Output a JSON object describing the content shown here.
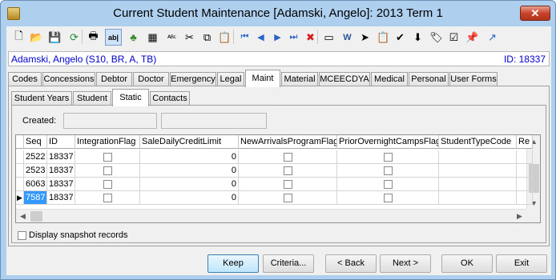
{
  "window": {
    "title": "Current Student Maintenance  [Adamski, Angelo]:  2013 Term 1",
    "close_glyph": "✕"
  },
  "toolbar": {
    "buttons": [
      {
        "name": "new-icon",
        "glyph": "🗋"
      },
      {
        "name": "open-folder-icon",
        "glyph": "📂"
      },
      {
        "name": "save-icon",
        "glyph": "💾"
      },
      {
        "name": "refresh-icon",
        "glyph": "⟳"
      },
      {
        "name": "print-icon",
        "glyph": "🖶"
      },
      {
        "name": "field-view-icon",
        "glyph": "ab|",
        "pressed": true
      },
      {
        "name": "tree-icon",
        "glyph": "♣"
      },
      {
        "name": "calculator-icon",
        "glyph": "▦"
      },
      {
        "name": "spellcheck-icon",
        "glyph": "ᴬᴮᶜ"
      },
      {
        "name": "cut-icon",
        "glyph": "✂"
      },
      {
        "name": "copy-icon",
        "glyph": "⧉"
      },
      {
        "name": "paste-icon",
        "glyph": "📋"
      },
      {
        "name": "first-record-icon",
        "glyph": "⏮"
      },
      {
        "name": "previous-record-icon",
        "glyph": "◀"
      },
      {
        "name": "next-record-icon",
        "glyph": "▶"
      },
      {
        "name": "last-record-icon",
        "glyph": "⏭"
      },
      {
        "name": "delete-icon",
        "glyph": "✖"
      },
      {
        "name": "form-icon",
        "glyph": "▭"
      },
      {
        "name": "word-icon",
        "glyph": "W"
      },
      {
        "name": "send-icon",
        "glyph": "➤"
      },
      {
        "name": "clipboard-icon",
        "glyph": "📋"
      },
      {
        "name": "approve-icon",
        "glyph": "✔"
      },
      {
        "name": "download-icon",
        "glyph": "⬇"
      },
      {
        "name": "tag-icon",
        "glyph": "🏷"
      },
      {
        "name": "checklist-icon",
        "glyph": "☑"
      },
      {
        "name": "pin-icon",
        "glyph": "📌"
      },
      {
        "name": "arrow-up-right-icon",
        "glyph": "↗"
      }
    ]
  },
  "student": {
    "name": "Adamski, Angelo (S10, BR, A, TB)",
    "id_label": "ID: 18337"
  },
  "main_tabs": [
    "Codes",
    "Concessions",
    "Debtor",
    "Doctor",
    "Emergency",
    "Legal",
    "Maint",
    "Material",
    "MCEECDYA",
    "Medical",
    "Personal",
    "User Forms"
  ],
  "main_active_tab": "Maint",
  "sub_tabs": [
    "Student Years",
    "Student",
    "Static",
    "Contacts"
  ],
  "sub_active_tab": "Static",
  "created": {
    "label": "Created:",
    "value1": "",
    "value2": ""
  },
  "grid": {
    "columns": [
      "Seq",
      "ID",
      "IntegrationFlag",
      "SaleDailyCreditLimit",
      "NewArrivalsProgramFlag",
      "PriorOvernightCampsFlag",
      "StudentTypeCode",
      "Re"
    ],
    "rows": [
      {
        "seq": "2522",
        "id": "18337",
        "limit": "0"
      },
      {
        "seq": "2523",
        "id": "18337",
        "limit": "0"
      },
      {
        "seq": "6063",
        "id": "18337",
        "limit": "0"
      },
      {
        "seq": "7587",
        "id": "18337",
        "limit": "0",
        "current": true
      }
    ],
    "current_row_indicator": "▶"
  },
  "snapshot": {
    "label": "Display snapshot records",
    "checked": false
  },
  "buttons": {
    "keep": "Keep",
    "criteria": "Criteria...",
    "back": "< Back",
    "next": "Next >",
    "ok": "OK",
    "exit": "Exit"
  }
}
